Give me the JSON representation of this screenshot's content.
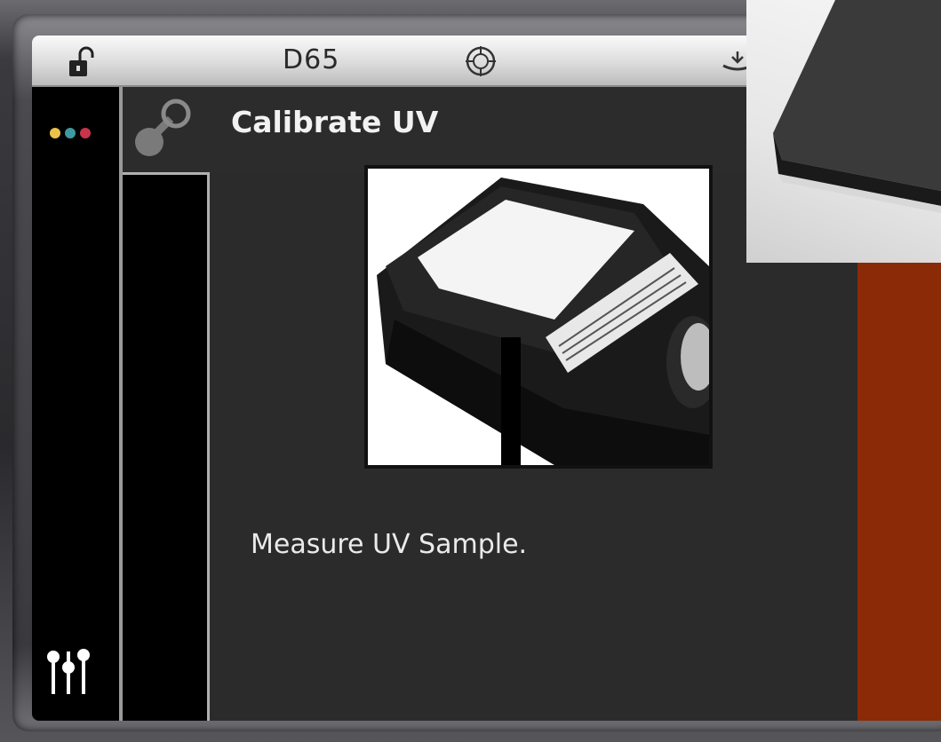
{
  "statusbar": {
    "illuminant": "D65",
    "icons": [
      "unlock-icon",
      "target-icon",
      "station-icon"
    ]
  },
  "leftbar": {
    "status_dots": [
      "#e9c24a",
      "#3f9aa0",
      "#c8344b"
    ],
    "icons": [
      "sliders-icon"
    ]
  },
  "header": {
    "title": "Calibrate UV",
    "icon": "chain-link-icon"
  },
  "content": {
    "image": "uv-calibration-tile-photo",
    "message": "Measure UV Sample."
  },
  "colors": {
    "accent": "#8a2a06",
    "screen_bg": "#2b2b2b"
  }
}
